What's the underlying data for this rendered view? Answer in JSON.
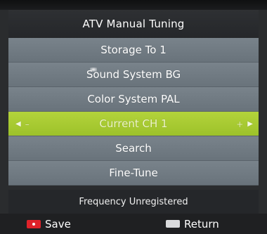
{
  "title": "ATV Manual Tuning",
  "menu": {
    "items": [
      {
        "label": "Storage To 1"
      },
      {
        "label": "Sound System BG"
      },
      {
        "label": "Color System PAL"
      },
      {
        "label": "Current CH 1",
        "selected": true,
        "left_symbol": "–",
        "right_symbol": "+"
      },
      {
        "label": "Search"
      },
      {
        "label": "Fine-Tune"
      }
    ]
  },
  "status": "Frequency Unregistered",
  "footer": {
    "save_label": "Save",
    "return_label": "Return"
  },
  "colors": {
    "item_bg": "#717b83",
    "selected_bg": "#a8ca32",
    "title_bg": "#2a2c2e",
    "save_key": "#e0222a"
  }
}
